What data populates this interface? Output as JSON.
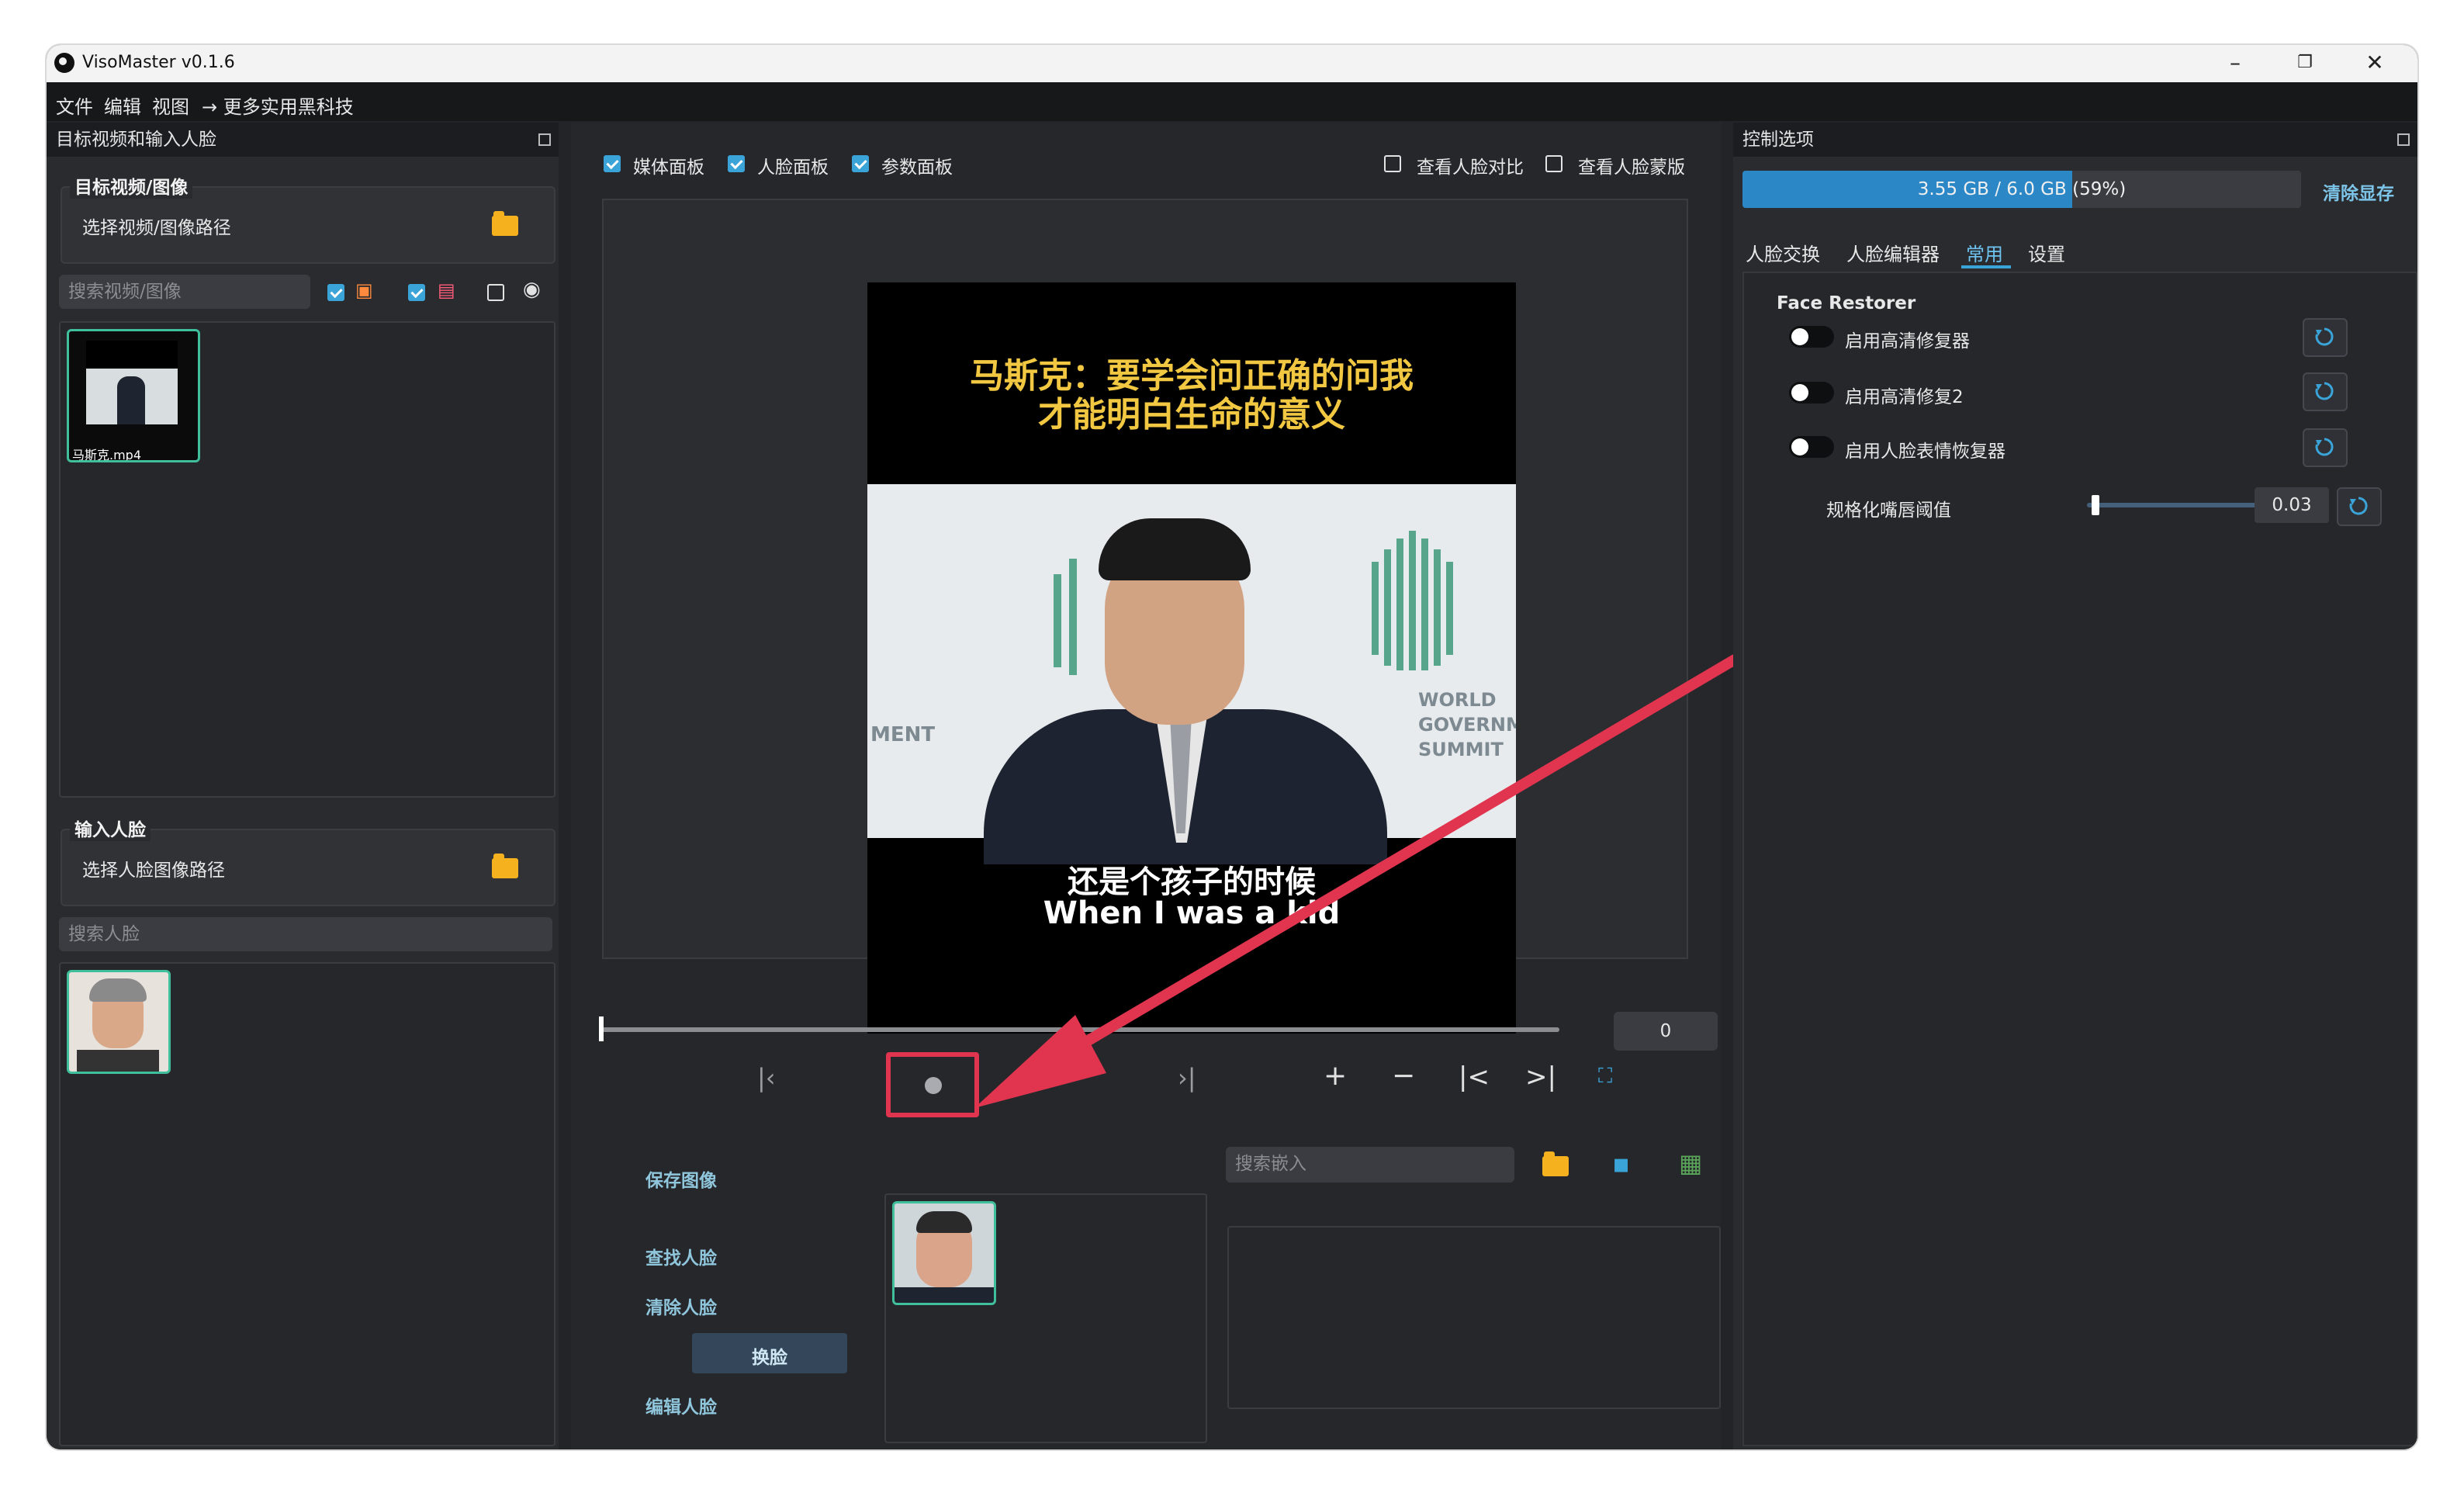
{
  "window": {
    "title": "VisoMaster v0.1.6"
  },
  "menu": [
    "文件",
    "编辑",
    "视图",
    "→ 更多实用黑科技"
  ],
  "left": {
    "header": "目标视频和输入人脸",
    "target_group": "目标视频/图像",
    "select_video": "选择视频/图像路径",
    "search_video_placeholder": "搜索视频/图像",
    "filters": {
      "videos": true,
      "images": true,
      "webcam": false
    },
    "video_file": "马斯克.mp4",
    "input_group": "输入人脸",
    "select_face": "选择人脸图像路径",
    "search_face_placeholder": "搜索人脸"
  },
  "center": {
    "checks": {
      "media_panel": "媒体面板",
      "face_panel": "人脸面板",
      "param_panel": "参数面板",
      "compare": "查看人脸对比",
      "mask": "查看人脸蒙版"
    },
    "video": {
      "title_line1": "马斯克：要学会问正确的问我",
      "title_line2": "才能明白生命的意义",
      "sub_cn": "还是个孩子的时候",
      "sub_en": "When I was a kid",
      "sign_left": "MENT",
      "sign_world": "WORLD",
      "sign_gov": "GOVERNMEN",
      "sign_summit": "SUMMIT"
    },
    "frame_value": "0",
    "actions": {
      "save_image": "保存图像",
      "find_faces": "查找人脸",
      "clear_faces": "清除人脸",
      "swap_faces": "换脸",
      "edit_faces": "编辑人脸"
    },
    "embed_search_placeholder": "搜索嵌入"
  },
  "right": {
    "header": "控制选项",
    "vram": {
      "label": "3.55 GB / 6.0 GB",
      "percent_text": "(59%)",
      "fraction": 0.59
    },
    "clear_vram": "清除显存",
    "tabs": [
      "人脸交换",
      "人脸编辑器",
      "常用",
      "设置"
    ],
    "active_tab": "常用",
    "section": "Face Restorer",
    "options": [
      "启用高清修复器",
      "启用高清修复2",
      "启用人脸表情恢复器"
    ],
    "slider_label": "规格化嘴唇阈值",
    "slider_value": "0.03",
    "slider_fraction": 0.03
  },
  "colors": {
    "accent": "#3aa4d8",
    "highlight": "#e0344f",
    "thumb_border": "#3fbf9c"
  }
}
